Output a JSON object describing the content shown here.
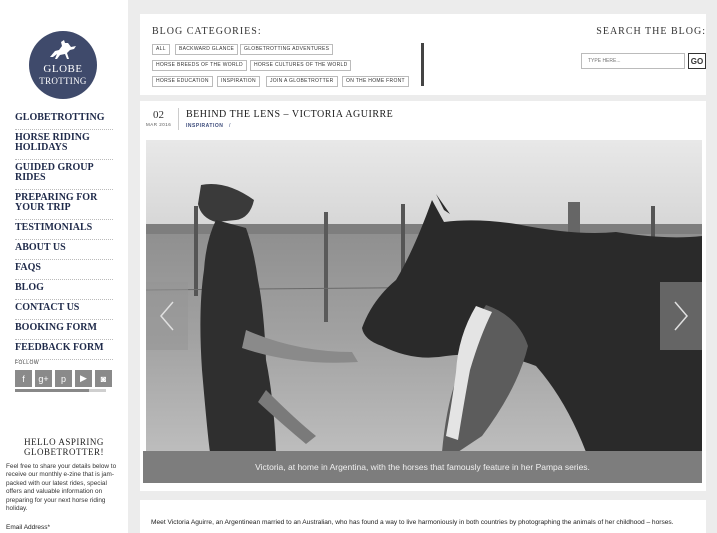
{
  "logo": {
    "line1": "GLOBE",
    "line2": "TROTTING"
  },
  "nav": [
    "Globetrotting",
    "Horse Riding Holidays",
    "Guided Group Rides",
    "Preparing for your trip",
    "Testimonials",
    "About Us",
    "FAQs",
    "Blog",
    "Contact Us",
    "Booking Form",
    "Feedback Form"
  ],
  "follow": {
    "label": "FOLLOW",
    "icons": [
      "f",
      "g+",
      "p",
      "▶",
      "◙"
    ]
  },
  "newsletter": {
    "title": "HELLO ASPIRING GLOBETROTTER!",
    "text": "Feel free to share your details below to receive our monthly e-zine that is jam-packed with our latest rides, special offers and valuable information on preparing for your next horse riding holiday.",
    "email_label": "Email Address*"
  },
  "header": {
    "categories_title": "BLOG CATEGORIES:",
    "categories": [
      "ALL",
      "BACKWARD GLANCE",
      "GLOBETROTTING ADVENTURES",
      "HORSE BREEDS OF THE WORLD",
      "HORSE CULTURES OF THE WORLD",
      "HORSE EDUCATION",
      "INSPIRATION",
      "JOIN A GLOBETROTTER",
      "ON THE HOME FRONT"
    ],
    "search_title": "SEARCH THE BLOG:",
    "search_placeholder": "TYPE HERE...",
    "search_button": "GO"
  },
  "post": {
    "day": "02",
    "month": "MAR 2016",
    "title": "BEHIND THE LENS – VICTORIA AGUIRRE",
    "category": "INSPIRATION",
    "category_sep": "/",
    "caption": "Victoria, at home in Argentina, with the horses that famously feature in her Pampa series.",
    "body": "Meet Victoria Aguirre, an Argentinean married to an Australian, who has found a way to live harmoniously in both countries by photographing the animals of her childhood – horses."
  }
}
